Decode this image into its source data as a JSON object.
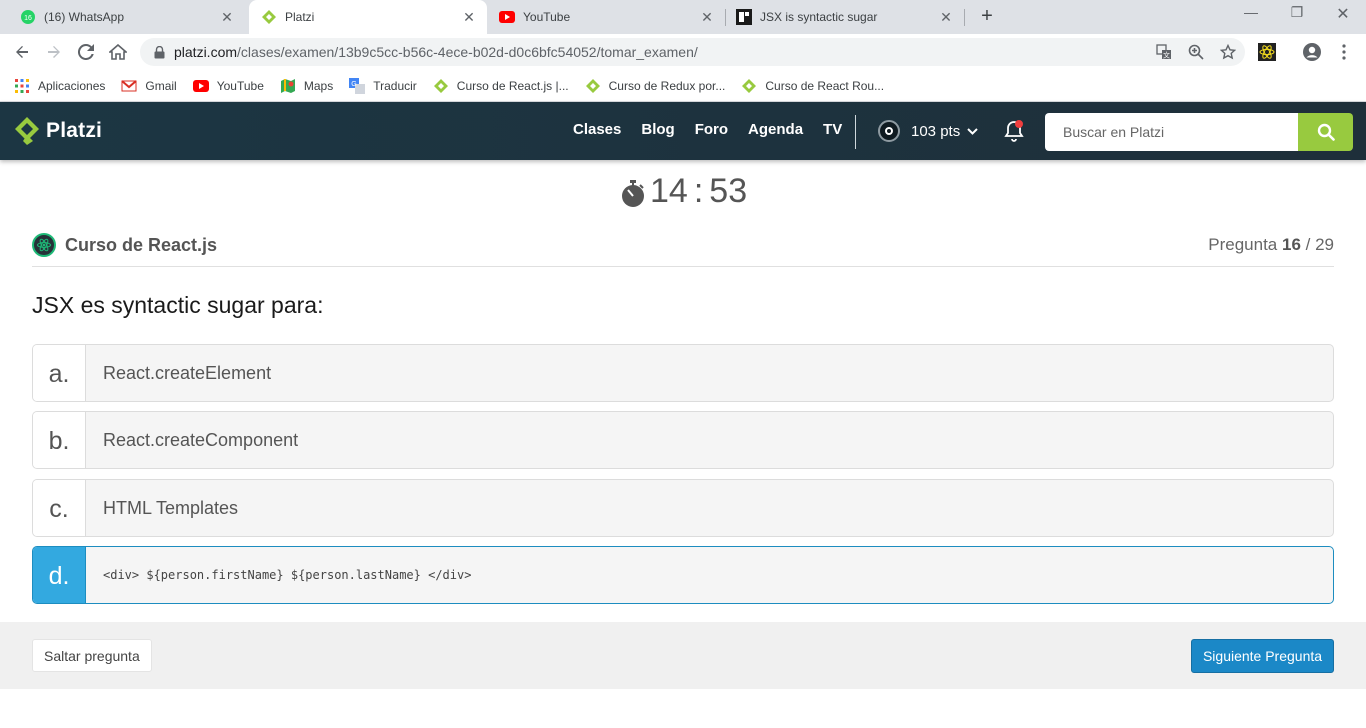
{
  "browser": {
    "tabs": [
      {
        "title": "(16) WhatsApp",
        "favicon": "whatsapp-icon",
        "badge": "16",
        "active": false
      },
      {
        "title": "Platzi",
        "favicon": "platzi-icon",
        "active": true
      },
      {
        "title": "YouTube",
        "favicon": "youtube-icon",
        "active": false
      },
      {
        "title": "JSX is syntactic sugar",
        "favicon": "page-icon",
        "active": false
      }
    ],
    "new_tab": "+",
    "url_domain": "platzi.com",
    "url_path": "/clases/examen/13b9c5cc-b56c-4ece-b02d-d0c6bfc54052/tomar_examen/",
    "bookmarks": [
      {
        "label": "Aplicaciones",
        "icon": "apps-grid-icon"
      },
      {
        "label": "Gmail",
        "icon": "gmail-icon"
      },
      {
        "label": "YouTube",
        "icon": "youtube-icon"
      },
      {
        "label": "Maps",
        "icon": "maps-icon"
      },
      {
        "label": "Traducir",
        "icon": "translate-icon"
      },
      {
        "label": "Curso de React.js |...",
        "icon": "platzi-icon"
      },
      {
        "label": "Curso de Redux por...",
        "icon": "platzi-icon"
      },
      {
        "label": "Curso de React Rou...",
        "icon": "platzi-icon"
      }
    ]
  },
  "header": {
    "logo_text": "Platzi",
    "nav": [
      "Clases",
      "Blog",
      "Foro",
      "Agenda",
      "TV"
    ],
    "points": "103 pts",
    "search_placeholder": "Buscar en Platzi"
  },
  "exam": {
    "timer_minutes": "14",
    "timer_sep": ":",
    "timer_seconds": "53",
    "course_name": "Curso de React.js",
    "question_label": "Pregunta",
    "question_current": "16",
    "question_total": "/ 29",
    "question_text": "JSX es syntactic sugar para:",
    "options": [
      {
        "letter": "a.",
        "text": "React.createElement",
        "selected": false
      },
      {
        "letter": "b.",
        "text": "React.createComponent",
        "selected": false
      },
      {
        "letter": "c.",
        "text": "HTML Templates",
        "selected": false
      },
      {
        "letter": "d.",
        "text": "<div> ${person.firstName} ${person.lastName} </div>",
        "selected": true
      }
    ],
    "skip_label": "Saltar pregunta",
    "next_label": "Siguiente Pregunta"
  },
  "colors": {
    "header_bg": "#1c3643",
    "accent_green": "#98ca3f",
    "selected_blue": "#33a9e0",
    "next_button": "#1b88c7"
  }
}
